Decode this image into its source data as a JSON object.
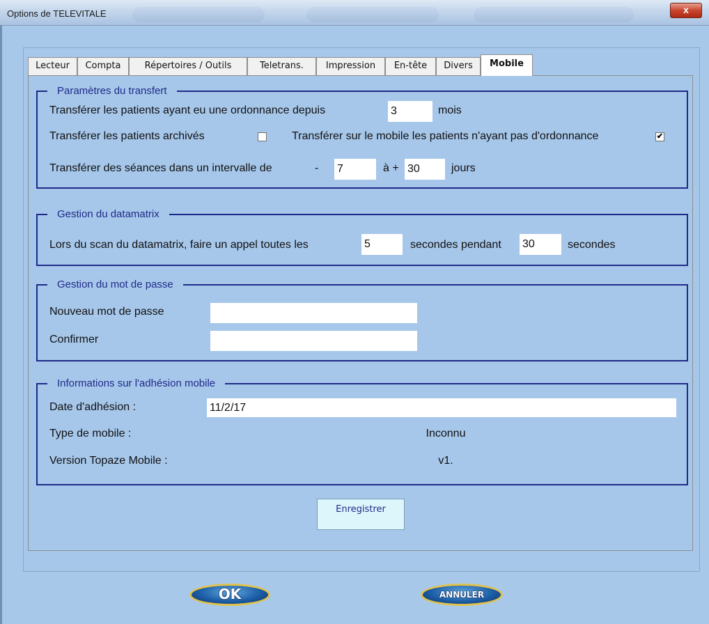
{
  "window": {
    "title": "Options de TELEVITALE",
    "close_label": "x"
  },
  "tabs": [
    {
      "label": "Lecteur"
    },
    {
      "label": "Compta"
    },
    {
      "label": "Répertoires / Outils"
    },
    {
      "label": "Teletrans."
    },
    {
      "label": "Impression"
    },
    {
      "label": "En-tête"
    },
    {
      "label": "Divers"
    },
    {
      "label": "Mobile",
      "active": true
    }
  ],
  "transfer": {
    "legend": "Paramètres du transfert",
    "since_label": "Transférer les patients ayant eu une ordonnance depuis",
    "since_value": "3",
    "since_unit": "mois",
    "archived_label": "Transférer les patients archivés",
    "archived_checked": false,
    "no_prescription_label": "Transférer sur le mobile les patients n'ayant pas d'ordonnance",
    "no_prescription_checked": true,
    "interval_label": "Transférer des séances dans un intervalle de",
    "interval_minus": "-",
    "interval_before": "7",
    "interval_plus": "à +",
    "interval_after": "30",
    "interval_unit": "jours"
  },
  "datamatrix": {
    "legend": "Gestion du datamatrix",
    "scan_label": "Lors du scan du datamatrix, faire un appel toutes les",
    "every_value": "5",
    "during_label": "secondes pendant",
    "during_value": "30",
    "unit": "secondes"
  },
  "password": {
    "legend": "Gestion du mot de passe",
    "new_label": "Nouveau mot de passe",
    "new_value": "",
    "confirm_label": "Confirmer",
    "confirm_value": ""
  },
  "membership": {
    "legend": "Informations sur l'adhésion mobile",
    "date_label": "Date d'adhésion :",
    "date_value": "11/2/17",
    "type_label": "Type de mobile :",
    "type_value": "Inconnu",
    "version_label": "Version Topaze Mobile :",
    "version_value": "v1."
  },
  "buttons": {
    "save": "Enregistrer",
    "ok": "OK",
    "cancel": "ANNULER"
  },
  "colors": {
    "background": "#a6c7ea",
    "group_border": "#1f2a88",
    "legend_text": "#1f2a88"
  }
}
